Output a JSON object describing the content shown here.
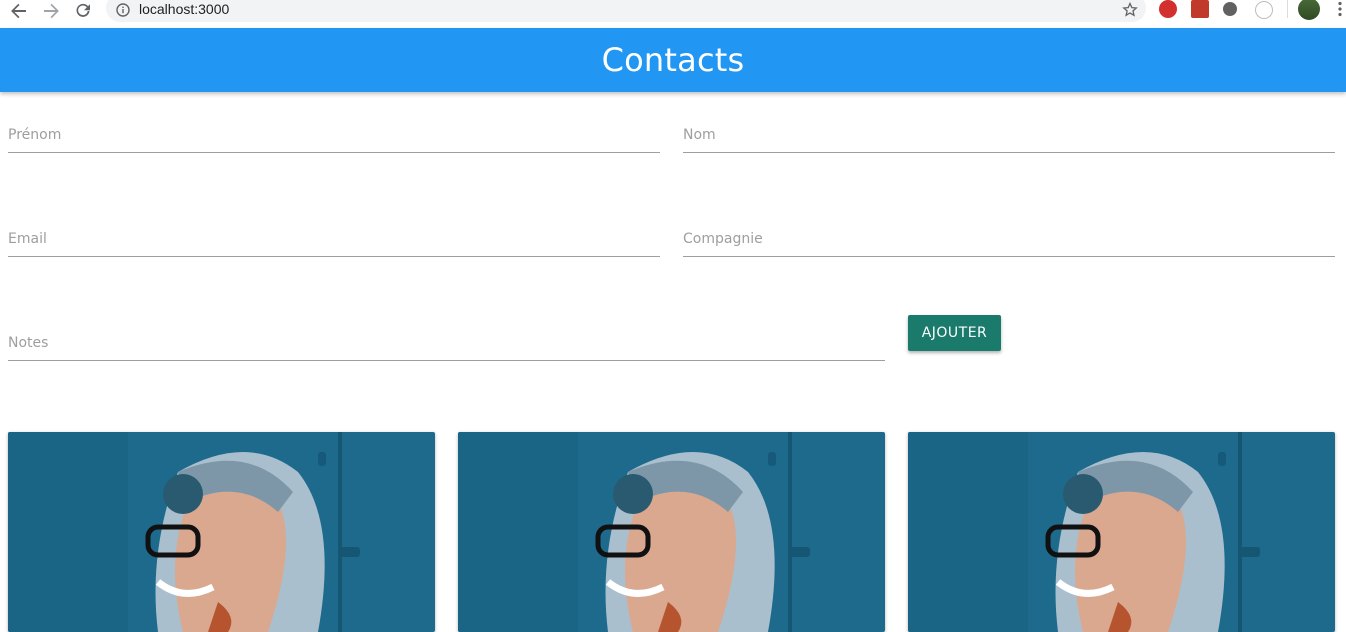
{
  "browser": {
    "url": "localhost:3000"
  },
  "header": {
    "title": "Contacts",
    "color": "#2196f3"
  },
  "form": {
    "first_name": {
      "label": "Prénom",
      "value": ""
    },
    "last_name": {
      "label": "Nom",
      "value": ""
    },
    "email": {
      "label": "Email",
      "value": ""
    },
    "company": {
      "label": "Compagnie",
      "value": ""
    },
    "notes": {
      "label": "Notes",
      "value": ""
    },
    "add_button": {
      "label": "Ajouter",
      "color": "#1a7a6b"
    }
  },
  "cards": [
    {
      "image": "contact-photo"
    },
    {
      "image": "contact-photo"
    },
    {
      "image": "contact-photo"
    }
  ]
}
